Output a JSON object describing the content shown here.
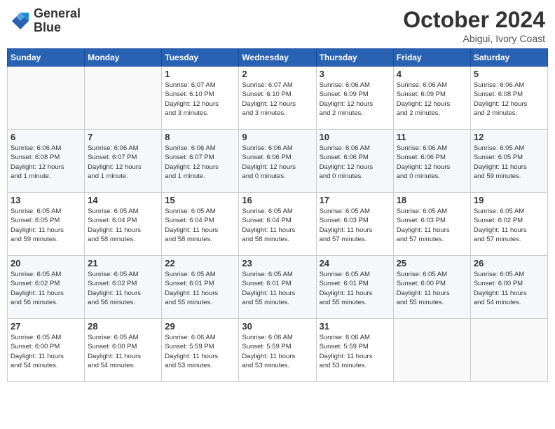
{
  "header": {
    "logo_line1": "General",
    "logo_line2": "Blue",
    "month": "October 2024",
    "location": "Abigui, Ivory Coast"
  },
  "days_of_week": [
    "Sunday",
    "Monday",
    "Tuesday",
    "Wednesday",
    "Thursday",
    "Friday",
    "Saturday"
  ],
  "weeks": [
    [
      {
        "day": "",
        "info": ""
      },
      {
        "day": "",
        "info": ""
      },
      {
        "day": "1",
        "info": "Sunrise: 6:07 AM\nSunset: 6:10 PM\nDaylight: 12 hours\nand 3 minutes."
      },
      {
        "day": "2",
        "info": "Sunrise: 6:07 AM\nSunset: 6:10 PM\nDaylight: 12 hours\nand 3 minutes."
      },
      {
        "day": "3",
        "info": "Sunrise: 6:06 AM\nSunset: 6:09 PM\nDaylight: 12 hours\nand 2 minutes."
      },
      {
        "day": "4",
        "info": "Sunrise: 6:06 AM\nSunset: 6:09 PM\nDaylight: 12 hours\nand 2 minutes."
      },
      {
        "day": "5",
        "info": "Sunrise: 6:06 AM\nSunset: 6:08 PM\nDaylight: 12 hours\nand 2 minutes."
      }
    ],
    [
      {
        "day": "6",
        "info": "Sunrise: 6:06 AM\nSunset: 6:08 PM\nDaylight: 12 hours\nand 1 minute."
      },
      {
        "day": "7",
        "info": "Sunrise: 6:06 AM\nSunset: 6:07 PM\nDaylight: 12 hours\nand 1 minute."
      },
      {
        "day": "8",
        "info": "Sunrise: 6:06 AM\nSunset: 6:07 PM\nDaylight: 12 hours\nand 1 minute."
      },
      {
        "day": "9",
        "info": "Sunrise: 6:06 AM\nSunset: 6:06 PM\nDaylight: 12 hours\nand 0 minutes."
      },
      {
        "day": "10",
        "info": "Sunrise: 6:06 AM\nSunset: 6:06 PM\nDaylight: 12 hours\nand 0 minutes."
      },
      {
        "day": "11",
        "info": "Sunrise: 6:06 AM\nSunset: 6:06 PM\nDaylight: 12 hours\nand 0 minutes."
      },
      {
        "day": "12",
        "info": "Sunrise: 6:05 AM\nSunset: 6:05 PM\nDaylight: 11 hours\nand 59 minutes."
      }
    ],
    [
      {
        "day": "13",
        "info": "Sunrise: 6:05 AM\nSunset: 6:05 PM\nDaylight: 11 hours\nand 59 minutes."
      },
      {
        "day": "14",
        "info": "Sunrise: 6:05 AM\nSunset: 6:04 PM\nDaylight: 11 hours\nand 58 minutes."
      },
      {
        "day": "15",
        "info": "Sunrise: 6:05 AM\nSunset: 6:04 PM\nDaylight: 11 hours\nand 58 minutes."
      },
      {
        "day": "16",
        "info": "Sunrise: 6:05 AM\nSunset: 6:04 PM\nDaylight: 11 hours\nand 58 minutes."
      },
      {
        "day": "17",
        "info": "Sunrise: 6:05 AM\nSunset: 6:03 PM\nDaylight: 11 hours\nand 57 minutes."
      },
      {
        "day": "18",
        "info": "Sunrise: 6:05 AM\nSunset: 6:03 PM\nDaylight: 11 hours\nand 57 minutes."
      },
      {
        "day": "19",
        "info": "Sunrise: 6:05 AM\nSunset: 6:02 PM\nDaylight: 11 hours\nand 57 minutes."
      }
    ],
    [
      {
        "day": "20",
        "info": "Sunrise: 6:05 AM\nSunset: 6:02 PM\nDaylight: 11 hours\nand 56 minutes."
      },
      {
        "day": "21",
        "info": "Sunrise: 6:05 AM\nSunset: 6:02 PM\nDaylight: 11 hours\nand 56 minutes."
      },
      {
        "day": "22",
        "info": "Sunrise: 6:05 AM\nSunset: 6:01 PM\nDaylight: 11 hours\nand 55 minutes."
      },
      {
        "day": "23",
        "info": "Sunrise: 6:05 AM\nSunset: 6:01 PM\nDaylight: 11 hours\nand 55 minutes."
      },
      {
        "day": "24",
        "info": "Sunrise: 6:05 AM\nSunset: 6:01 PM\nDaylight: 11 hours\nand 55 minutes."
      },
      {
        "day": "25",
        "info": "Sunrise: 6:05 AM\nSunset: 6:00 PM\nDaylight: 11 hours\nand 55 minutes."
      },
      {
        "day": "26",
        "info": "Sunrise: 6:05 AM\nSunset: 6:00 PM\nDaylight: 11 hours\nand 54 minutes."
      }
    ],
    [
      {
        "day": "27",
        "info": "Sunrise: 6:05 AM\nSunset: 6:00 PM\nDaylight: 11 hours\nand 54 minutes."
      },
      {
        "day": "28",
        "info": "Sunrise: 6:05 AM\nSunset: 6:00 PM\nDaylight: 11 hours\nand 54 minutes."
      },
      {
        "day": "29",
        "info": "Sunrise: 6:06 AM\nSunset: 5:59 PM\nDaylight: 11 hours\nand 53 minutes."
      },
      {
        "day": "30",
        "info": "Sunrise: 6:06 AM\nSunset: 5:59 PM\nDaylight: 11 hours\nand 53 minutes."
      },
      {
        "day": "31",
        "info": "Sunrise: 6:06 AM\nSunset: 5:59 PM\nDaylight: 11 hours\nand 53 minutes."
      },
      {
        "day": "",
        "info": ""
      },
      {
        "day": "",
        "info": ""
      }
    ]
  ]
}
